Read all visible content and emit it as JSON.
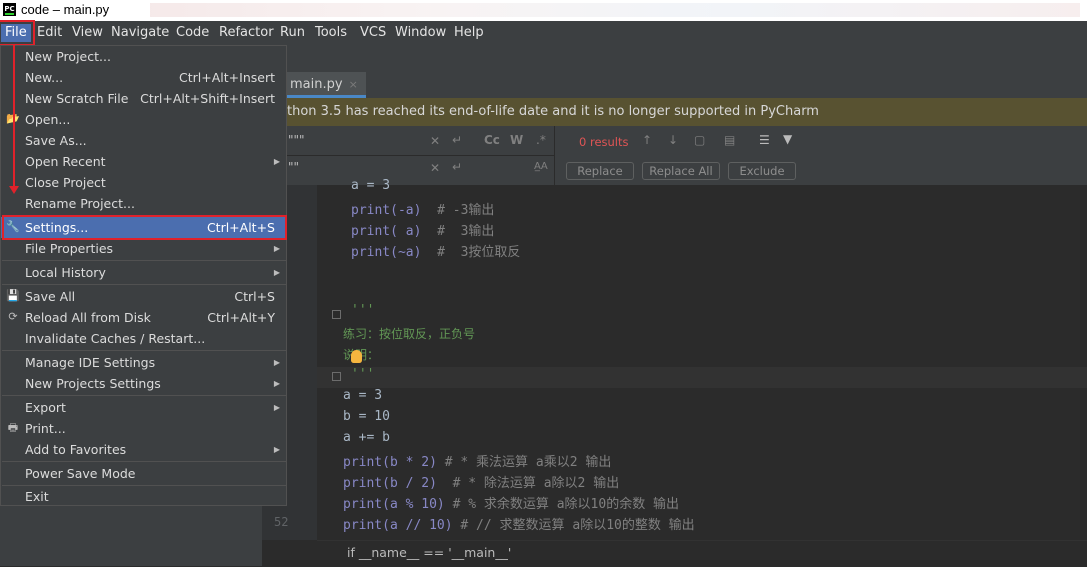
{
  "window": {
    "title": "code – main.py",
    "app_icon": "PC"
  },
  "menubar": {
    "items": [
      {
        "label": "File",
        "active": true
      },
      {
        "label": "Edit"
      },
      {
        "label": "View"
      },
      {
        "label": "Navigate"
      },
      {
        "label": "Code"
      },
      {
        "label": "Refactor"
      },
      {
        "label": "Run"
      },
      {
        "label": "Tools"
      },
      {
        "label": "VCS"
      },
      {
        "label": "Window"
      },
      {
        "label": "Help"
      }
    ]
  },
  "tab": {
    "label": "main.py",
    "close": "×"
  },
  "banner": {
    "text": "thon 3.5 has reached its end-of-life date and it is no longer supported in PyCharm"
  },
  "find": {
    "search_text": "\"\"\"",
    "replace_text": "\"\"",
    "results": "0 results",
    "buttons": {
      "replace": "Replace",
      "replace_all": "Replace All",
      "exclude": "Exclude"
    },
    "options": {
      "case": "Cc",
      "words": "W",
      "regex": ".*",
      "preserve_case": "A̲A"
    }
  },
  "file_menu": {
    "items": [
      {
        "label": "New Project...",
        "shortcut": ""
      },
      {
        "label": "New...",
        "shortcut": "Ctrl+Alt+Insert"
      },
      {
        "label": "New Scratch File",
        "shortcut": "Ctrl+Alt+Shift+Insert"
      },
      {
        "label": "Open...",
        "shortcut": "",
        "icon": "folder-icon"
      },
      {
        "label": "Save As...",
        "shortcut": ""
      },
      {
        "label": "Open Recent",
        "shortcut": "",
        "submenu": true
      },
      {
        "label": "Close Project",
        "shortcut": ""
      },
      {
        "label": "Rename Project...",
        "shortcut": ""
      },
      {
        "label": "Settings...",
        "shortcut": "Ctrl+Alt+S",
        "icon": "wrench-icon",
        "selected": true
      },
      {
        "label": "File Properties",
        "shortcut": "",
        "submenu": true
      },
      {
        "label": "Local History",
        "shortcut": "",
        "submenu": true
      },
      {
        "label": "Save All",
        "shortcut": "Ctrl+S",
        "icon": "save-icon"
      },
      {
        "label": "Reload All from Disk",
        "shortcut": "Ctrl+Alt+Y",
        "icon": "reload-icon"
      },
      {
        "label": "Invalidate Caches / Restart...",
        "shortcut": ""
      },
      {
        "label": "Manage IDE Settings",
        "shortcut": "",
        "submenu": true
      },
      {
        "label": "New Projects Settings",
        "shortcut": "",
        "submenu": true
      },
      {
        "label": "Export",
        "shortcut": "",
        "submenu": true
      },
      {
        "label": "Print...",
        "shortcut": "",
        "icon": "printer-icon"
      },
      {
        "label": "Add to Favorites",
        "shortcut": "",
        "submenu": true
      },
      {
        "label": "Power Save Mode",
        "shortcut": ""
      },
      {
        "label": "Exit",
        "shortcut": ""
      }
    ]
  },
  "editor": {
    "line_number": "52",
    "breadcrumb": "if __name__ == '__main__'",
    "lines": {
      "l0": "a = 3",
      "l1a": "print(-a)",
      "l1b": "  # -3输出",
      "l2a": "print( a)",
      "l2b": "  #  3输出",
      "l3a": "print(~a)",
      "l3b": "  #  3按位取反",
      "doc1": "'''",
      "doc2": "练习：按位取反，正负号",
      "doc3": "说明：",
      "doc4": "'''",
      "c1": "a = 3",
      "c2": "b = 10",
      "c3": "a += b",
      "c4a": "print(b * 2)",
      "c4b": " # * 乘法运算 a乘以2 输出",
      "c5a": "print(b / 2)",
      "c5b": "  # * 除法运算 a除以2 输出",
      "c6a": "print(a % 10)",
      "c6b": " # % 求余数运算 a除以10的余数 输出",
      "c7a": "print(a // 10)",
      "c7b": " # // 求整数运算 a除以10的整数 输出"
    }
  },
  "colors": {
    "accent": "#4b6eaf",
    "highlight_box": "#e0222b",
    "banner": "#585231"
  }
}
